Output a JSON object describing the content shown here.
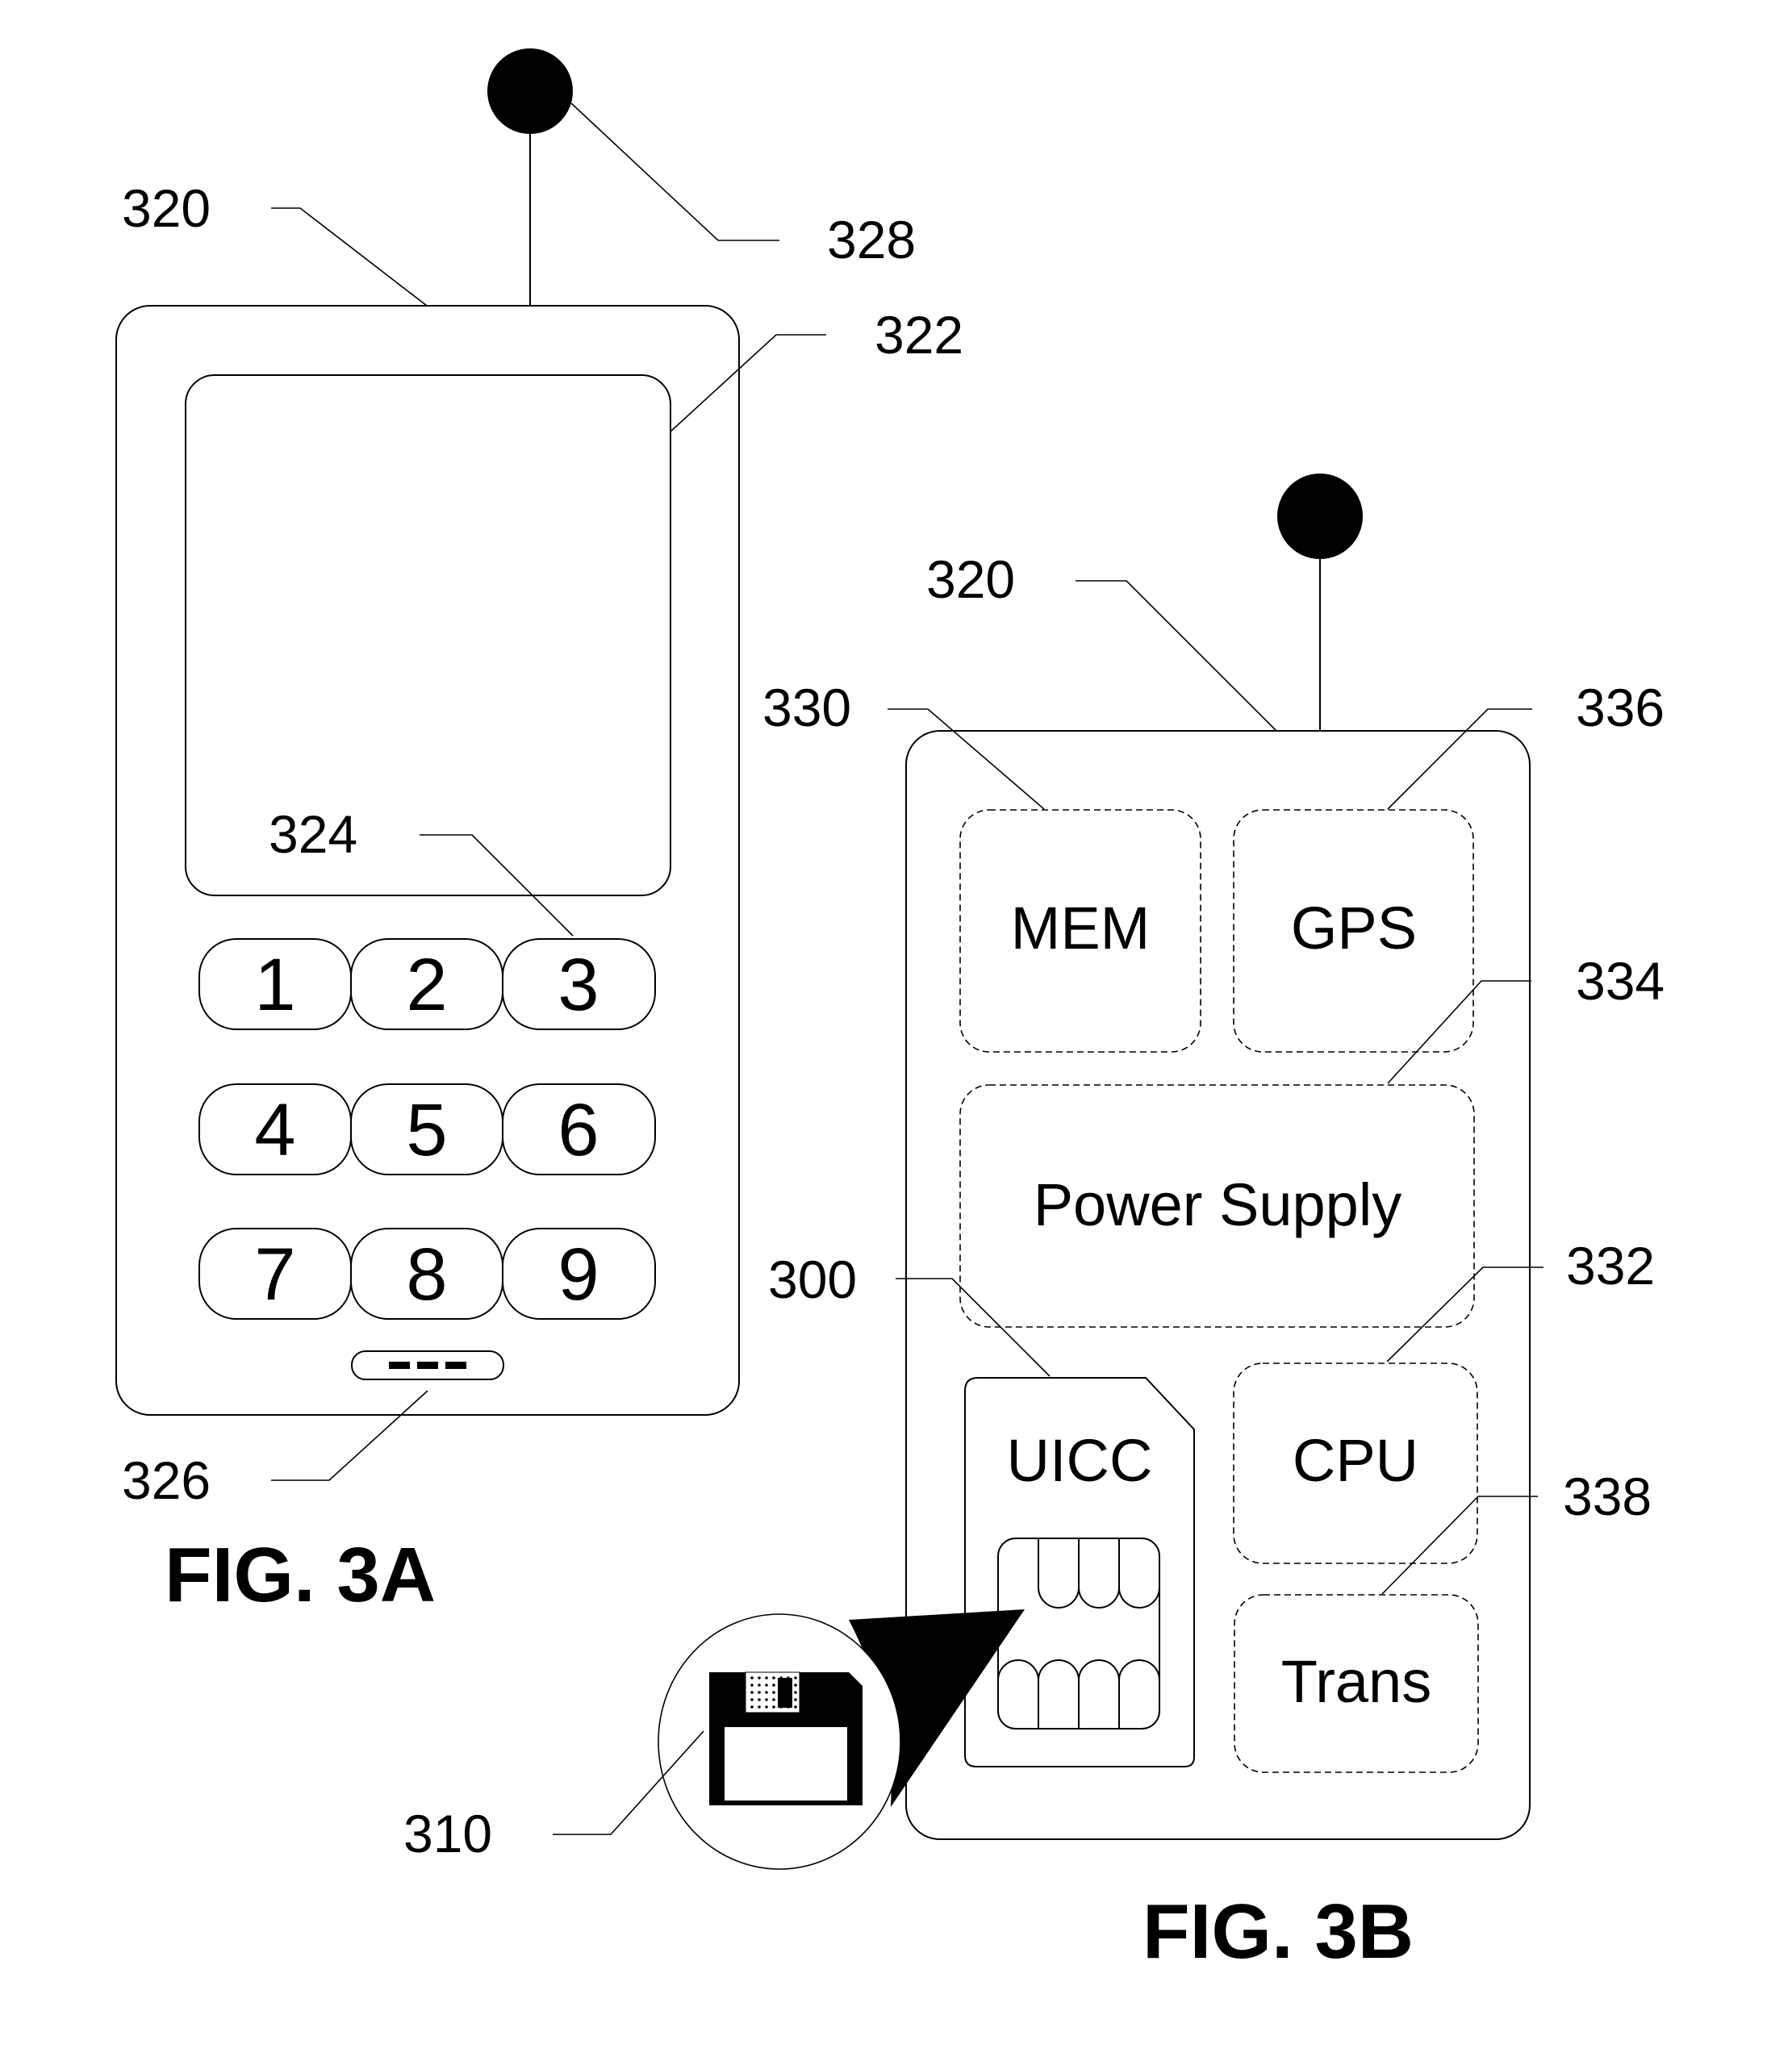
{
  "figure_3a": {
    "caption": "FIG. 3A",
    "labels": {
      "device": "320",
      "antenna": "328",
      "display": "322",
      "keypad": "324",
      "button": "326"
    },
    "keys": [
      "1",
      "2",
      "3",
      "4",
      "5",
      "6",
      "7",
      "8",
      "9"
    ],
    "button_glyph": "---"
  },
  "figure_3b": {
    "caption": "FIG. 3B",
    "labels": {
      "device": "320",
      "memory": "330",
      "gps": "336",
      "power": "334",
      "uicc": "300",
      "cpu": "332",
      "transceiver": "338",
      "storage": "310"
    },
    "modules": {
      "memory": "MEM",
      "gps": "GPS",
      "power": "Power Supply",
      "uicc": "UICC",
      "cpu": "CPU",
      "transceiver": "Trans"
    }
  },
  "colors": {
    "line": "#000000",
    "background": "#ffffff"
  }
}
